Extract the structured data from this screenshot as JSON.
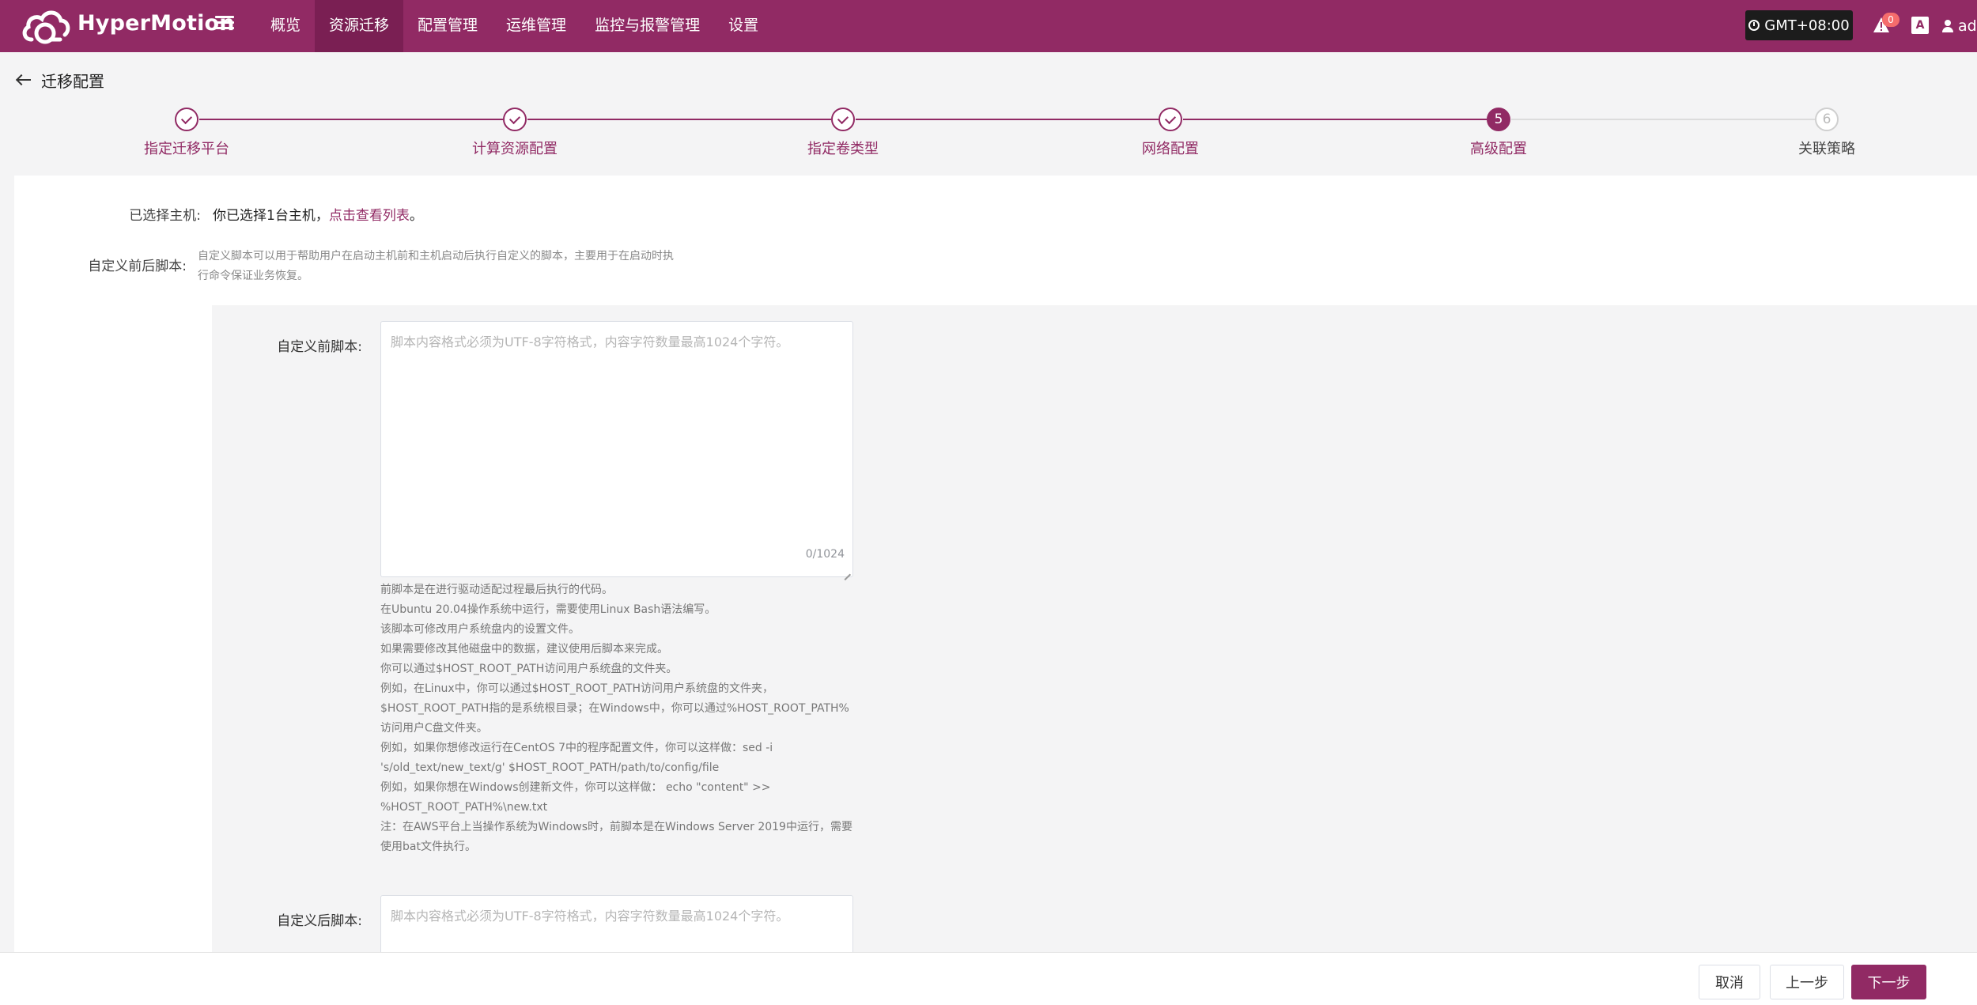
{
  "app": {
    "brand": "HyperMotion"
  },
  "nav": {
    "items": [
      {
        "label": "概览",
        "active": false
      },
      {
        "label": "资源迁移",
        "active": true
      },
      {
        "label": "配置管理",
        "active": false
      },
      {
        "label": "运维管理",
        "active": false
      },
      {
        "label": "监控与报警管理",
        "active": false
      },
      {
        "label": "设置",
        "active": false
      }
    ]
  },
  "topbar": {
    "timezone": "GMT+08:00",
    "notification_count": "0",
    "lang_icon_text": "A",
    "user_label": "adm"
  },
  "page": {
    "title": "迁移配置"
  },
  "steps": [
    {
      "number": "1",
      "label": "指定迁移平台",
      "status": "done"
    },
    {
      "number": "2",
      "label": "计算资源配置",
      "status": "done"
    },
    {
      "number": "3",
      "label": "指定卷类型",
      "status": "done"
    },
    {
      "number": "4",
      "label": "网络配置",
      "status": "done"
    },
    {
      "number": "5",
      "label": "高级配置",
      "status": "current"
    },
    {
      "number": "6",
      "label": "关联策略",
      "status": "pending"
    }
  ],
  "form": {
    "selected_host": {
      "label": "已选择主机:",
      "prefix": "你已选择1台主机，",
      "link": "点击查看列表",
      "suffix": "。"
    },
    "custom_script": {
      "label": "自定义前后脚本:",
      "description": "自定义脚本可以用于帮助用户在启动主机前和主机启动后执行自定义的脚本，主要用于在启动时执行命令保证业务恢复。"
    },
    "pre_script": {
      "label": "自定义前脚本:",
      "placeholder": "脚本内容格式必须为UTF-8字符格式，内容字符数量最高1024个字符。",
      "counter": "0/1024",
      "hints": [
        "前脚本是在进行驱动适配过程最后执行的代码。",
        "在Ubuntu 20.04操作系统中运行，需要使用Linux Bash语法编写。",
        "该脚本可修改用户系统盘内的设置文件。",
        "如果需要修改其他磁盘中的数据，建议使用后脚本来完成。",
        "你可以通过$HOST_ROOT_PATH访问用户系统盘的文件夹。",
        "例如，在Linux中，你可以通过$HOST_ROOT_PATH访问用户系统盘的文件夹，$HOST_ROOT_PATH指的是系统根目录；在Windows中，你可以通过%HOST_ROOT_PATH%访问用户C盘文件夹。",
        "例如，如果你想修改运行在CentOS 7中的程序配置文件，你可以这样做：sed -i 's/old_text/new_text/g' $HOST_ROOT_PATH/path/to/config/file",
        "例如，如果你想在Windows创建新文件，你可以这样做： echo \"content\" >> %HOST_ROOT_PATH%\\new.txt",
        "注：在AWS平台上当操作系统为Windows时，前脚本是在Windows Server 2019中运行，需要使用bat文件执行。"
      ]
    },
    "post_script": {
      "label": "自定义后脚本:",
      "placeholder": "脚本内容格式必须为UTF-8字符格式，内容字符数量最高1024个字符。"
    }
  },
  "footer": {
    "cancel": "取消",
    "prev": "上一步",
    "next": "下一步"
  },
  "colors": {
    "brand": "#912a64",
    "brand_dark": "#7a1f53",
    "badge": "#f56c6c",
    "pending": "#cfcfcf"
  }
}
